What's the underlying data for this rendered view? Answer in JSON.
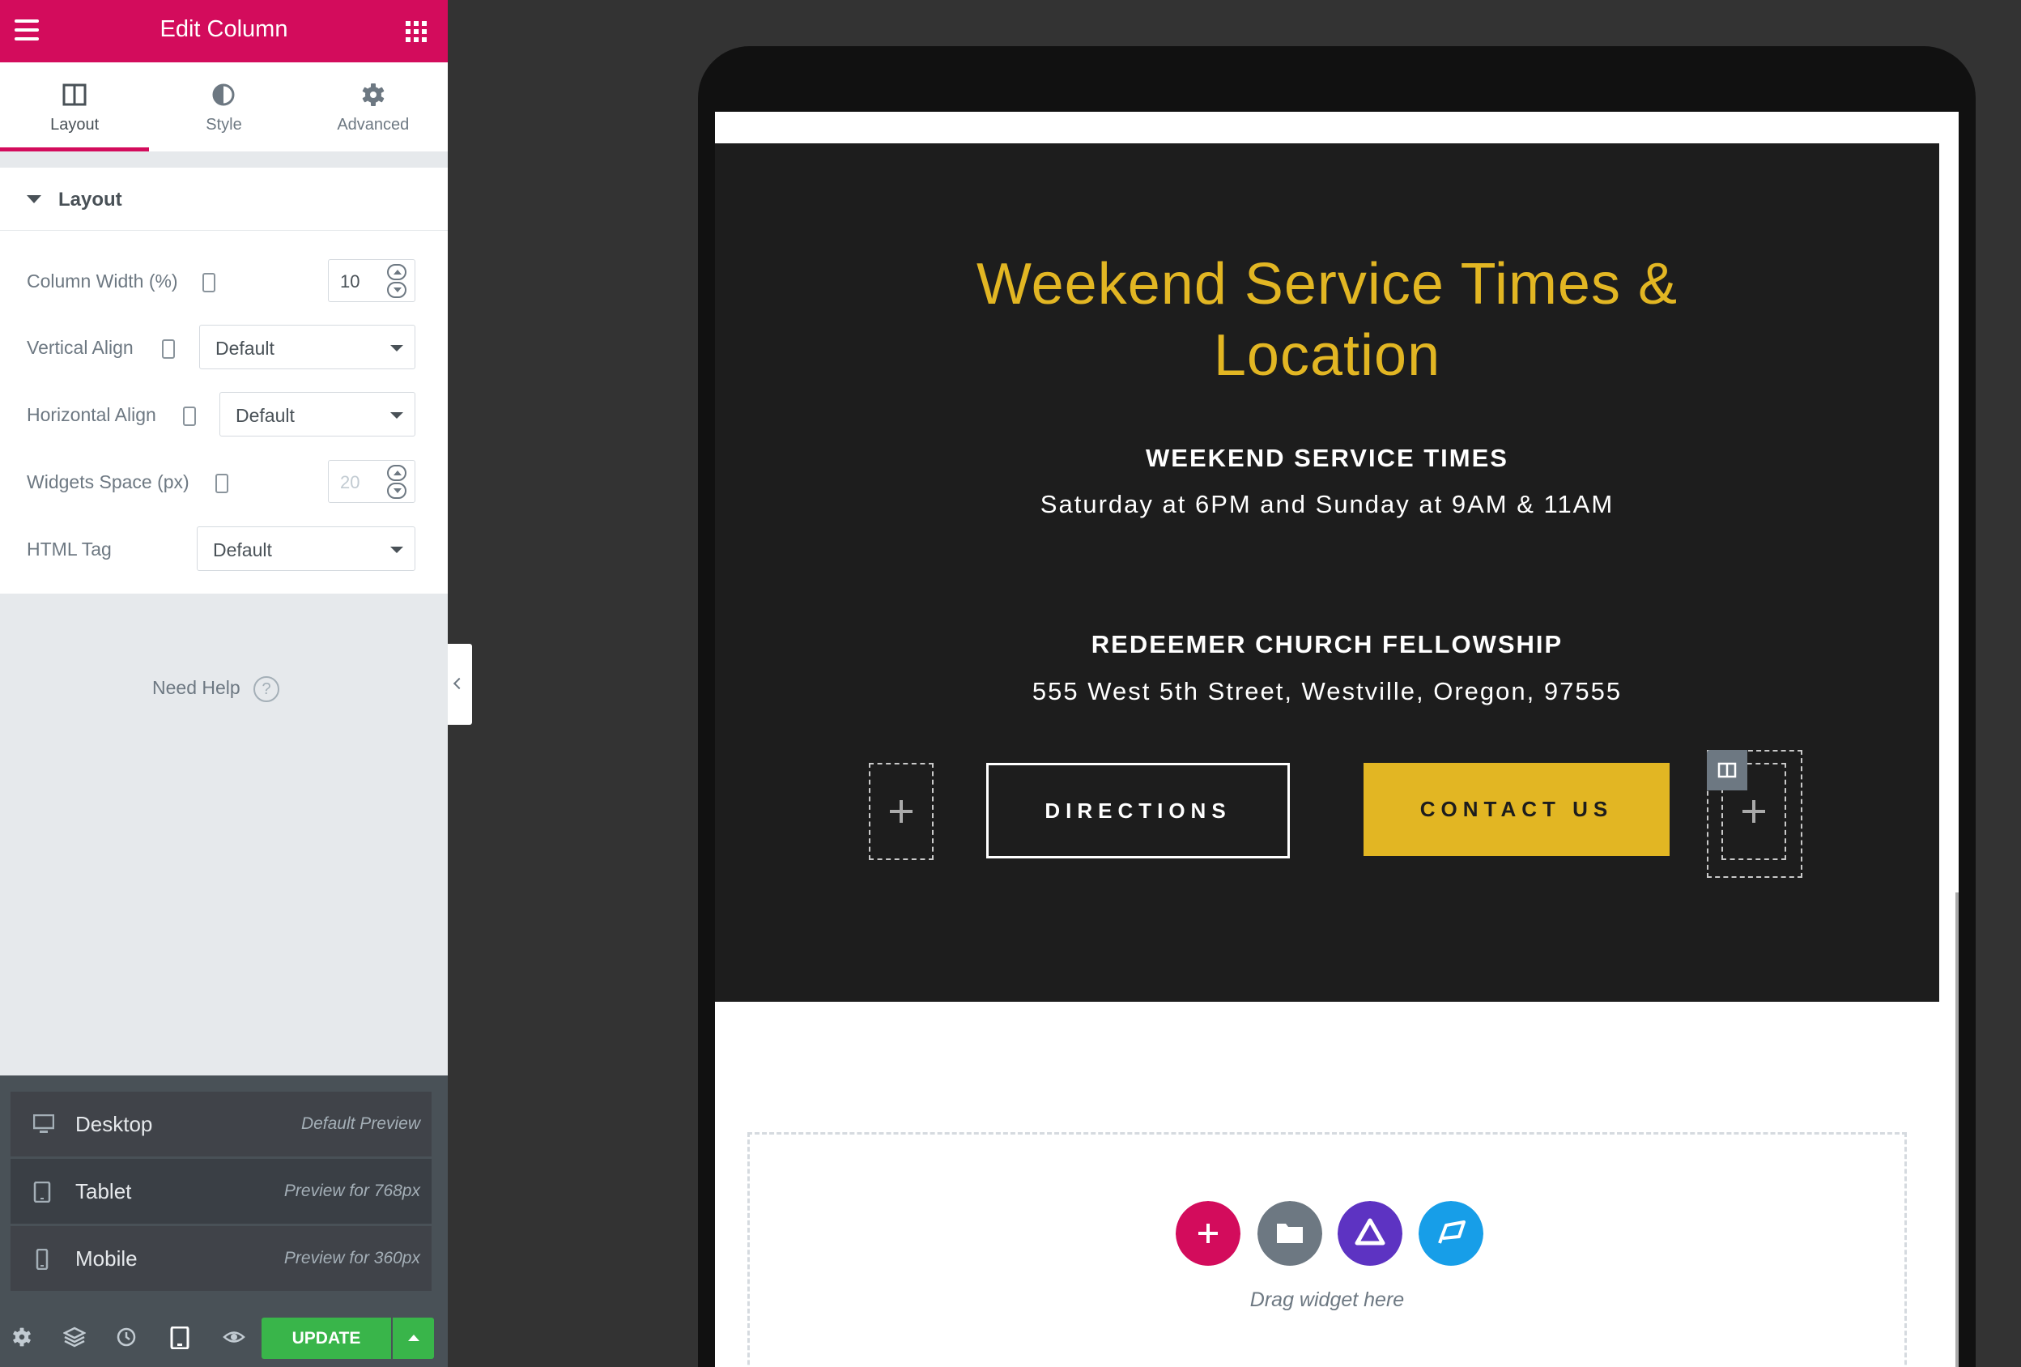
{
  "panel": {
    "title": "Edit Column",
    "tabs": [
      {
        "label": "Layout",
        "icon": "columns-icon",
        "active": true
      },
      {
        "label": "Style",
        "icon": "half-circle-icon",
        "active": false
      },
      {
        "label": "Advanced",
        "icon": "gear-icon",
        "active": false
      }
    ],
    "section_title": "Layout",
    "controls": {
      "column_width": {
        "label": "Column Width (%)",
        "value": "10"
      },
      "vertical_align": {
        "label": "Vertical Align",
        "value": "Default"
      },
      "horizontal_align": {
        "label": "Horizontal Align",
        "value": "Default"
      },
      "widgets_space": {
        "label": "Widgets Space (px)",
        "placeholder": "20"
      },
      "html_tag": {
        "label": "HTML Tag",
        "value": "Default"
      }
    },
    "need_help": "Need Help",
    "help_glyph": "?"
  },
  "responsive_menu": {
    "items": [
      {
        "name": "Desktop",
        "desc": "Default Preview",
        "icon": "desktop-icon"
      },
      {
        "name": "Tablet",
        "desc": "Preview for 768px",
        "icon": "tablet-icon"
      },
      {
        "name": "Mobile",
        "desc": "Preview for 360px",
        "icon": "mobile-icon"
      }
    ]
  },
  "footer": {
    "update_label": "UPDATE",
    "icons": [
      "settings-icon",
      "layers-icon",
      "history-icon",
      "responsive-icon",
      "preview-eye-icon"
    ]
  },
  "preview": {
    "hero_title": "Weekend Service Times & Location",
    "service_heading": "WEEKEND SERVICE TIMES",
    "service_text": "Saturday at 6PM and Sunday at 9AM & 11AM",
    "church_heading": "REDEEMER CHURCH FELLOWSHIP",
    "church_address": "555 West 5th Street, Westville, Oregon, 97555",
    "directions_label": "DIRECTIONS",
    "contact_label": "CONTACT US",
    "drag_widget": "Drag widget here"
  },
  "colors": {
    "brand": "#d30c5c",
    "accent_gold": "#e2b623",
    "hero_bg": "#1d1d1d",
    "update_green": "#39b54a",
    "folder_grey": "#6d7882",
    "purple": "#5d33c2",
    "blue": "#179ee8"
  }
}
